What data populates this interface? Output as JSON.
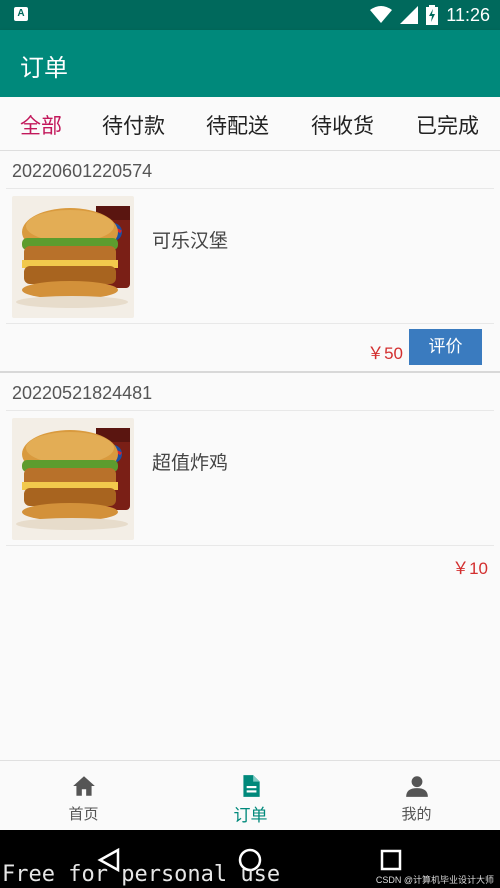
{
  "status_bar": {
    "time": "11:26",
    "app_badge": "A"
  },
  "app_bar": {
    "title": "订单"
  },
  "tabs": [
    {
      "label": "全部",
      "active": true
    },
    {
      "label": "待付款",
      "active": false
    },
    {
      "label": "待配送",
      "active": false
    },
    {
      "label": "待收货",
      "active": false
    },
    {
      "label": "已完成",
      "active": false
    }
  ],
  "orders": [
    {
      "id": "20220601220574",
      "product": "可乐汉堡",
      "price": "￥50",
      "action": "评价",
      "thumb_icon": "burger-cola-image"
    },
    {
      "id": "20220521824481",
      "product": "超值炸鸡",
      "price": "￥10",
      "thumb_icon": "burger-cola-image"
    }
  ],
  "bottom_nav": [
    {
      "label": "首页",
      "icon": "home-icon",
      "active": false
    },
    {
      "label": "订单",
      "icon": "document-icon",
      "active": true
    },
    {
      "label": "我的",
      "icon": "person-icon",
      "active": false
    }
  ],
  "system_nav": {
    "back": "back-triangle-icon",
    "home": "home-circle-icon",
    "recents": "recents-square-icon"
  },
  "watermark": "Free for personal use",
  "credit": "CSDN @计算机毕业设计大师",
  "colors": {
    "primary": "#00897b",
    "primary_dark": "#00695c",
    "accent": "#c2185b",
    "price": "#d32f2f",
    "button": "#3a7bbf"
  }
}
